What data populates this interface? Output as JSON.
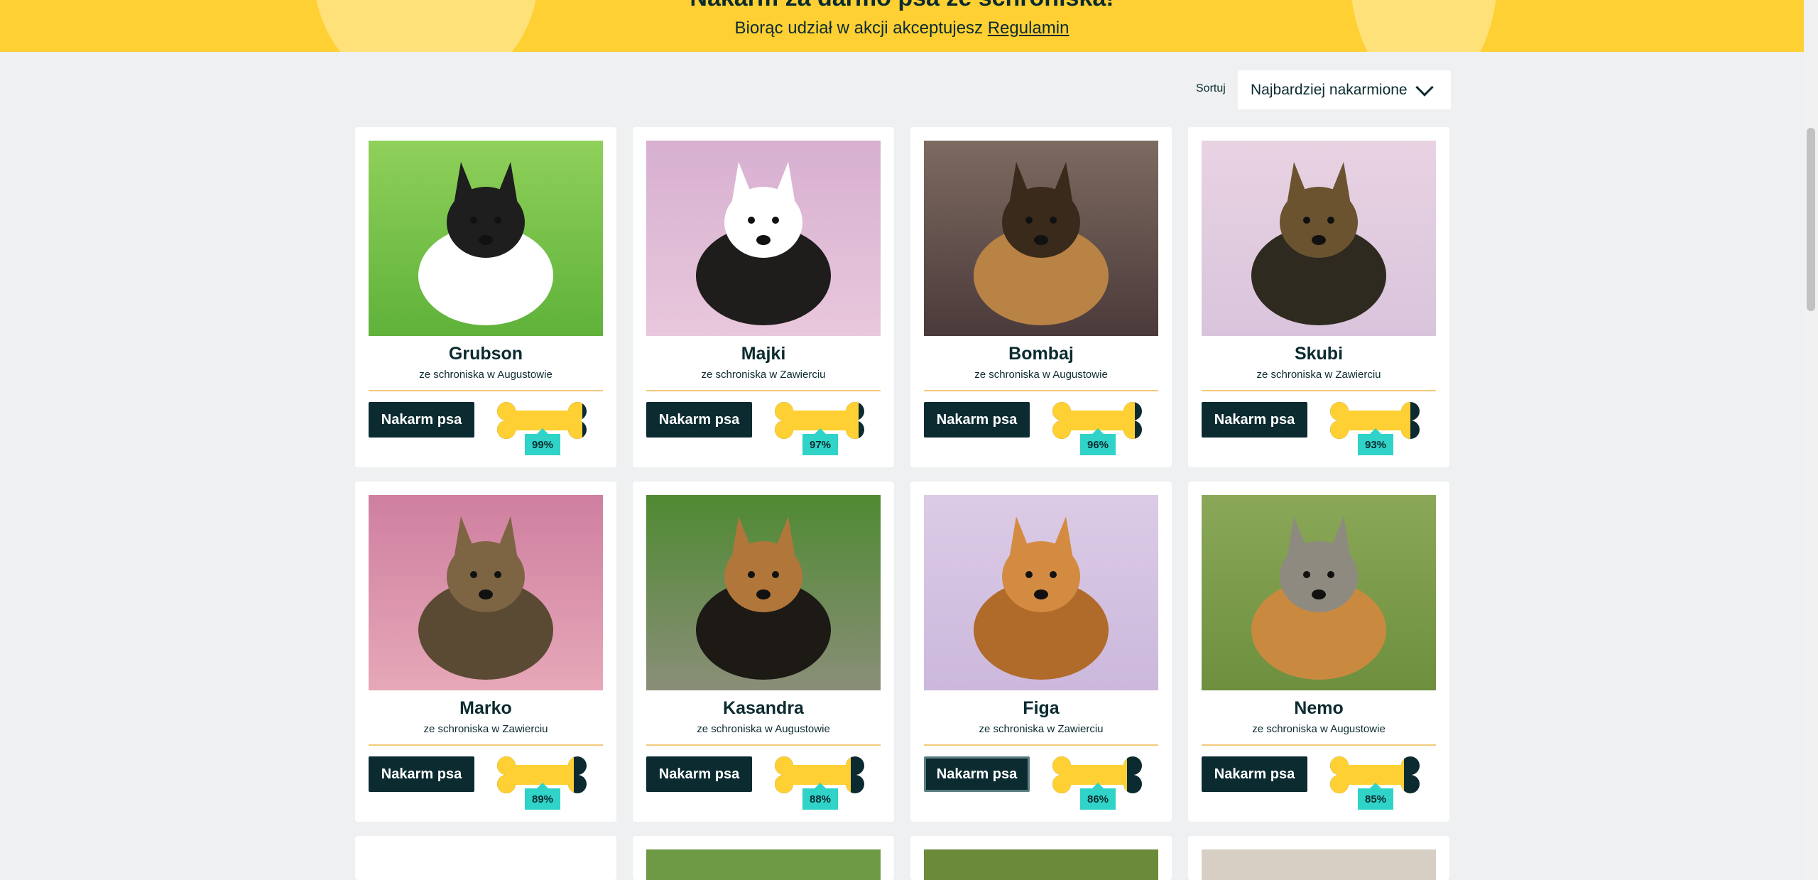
{
  "banner": {
    "title": "Nakarm za darmo psa ze schroniska!",
    "rules_prefix": "Biorąc udział w akcji akceptujesz",
    "rules_link": "Regulamin"
  },
  "sort": {
    "label": "Sortuj",
    "selected": "Najbardziej nakarmione"
  },
  "colors": {
    "banner": "#ffd033",
    "dark": "#0b2b30",
    "badge": "#2fd3c8",
    "bone": "#ffd033"
  },
  "dogs": [
    {
      "name": "Grubson",
      "shelter": "ze schroniska w Augustowie",
      "button": "Nakarm psa",
      "percent": "99%",
      "fed": 0.99
    },
    {
      "name": "Majki",
      "shelter": "ze schroniska w Zawierciu",
      "button": "Nakarm psa",
      "percent": "97%",
      "fed": 0.97
    },
    {
      "name": "Bombaj",
      "shelter": "ze schroniska w Augustowie",
      "button": "Nakarm psa",
      "percent": "96%",
      "fed": 0.96
    },
    {
      "name": "Skubi",
      "shelter": "ze schroniska w Zawierciu",
      "button": "Nakarm psa",
      "percent": "93%",
      "fed": 0.93
    },
    {
      "name": "Marko",
      "shelter": "ze schroniska w Zawierciu",
      "button": "Nakarm psa",
      "percent": "89%",
      "fed": 0.89
    },
    {
      "name": "Kasandra",
      "shelter": "ze schroniska w Augustowie",
      "button": "Nakarm psa",
      "percent": "88%",
      "fed": 0.88
    },
    {
      "name": "Figa",
      "shelter": "ze schroniska w Zawierciu",
      "button": "Nakarm psa",
      "percent": "86%",
      "fed": 0.86
    },
    {
      "name": "Nemo",
      "shelter": "ze schroniska w Augustowie",
      "button": "Nakarm psa",
      "percent": "85%",
      "fed": 0.85
    }
  ]
}
